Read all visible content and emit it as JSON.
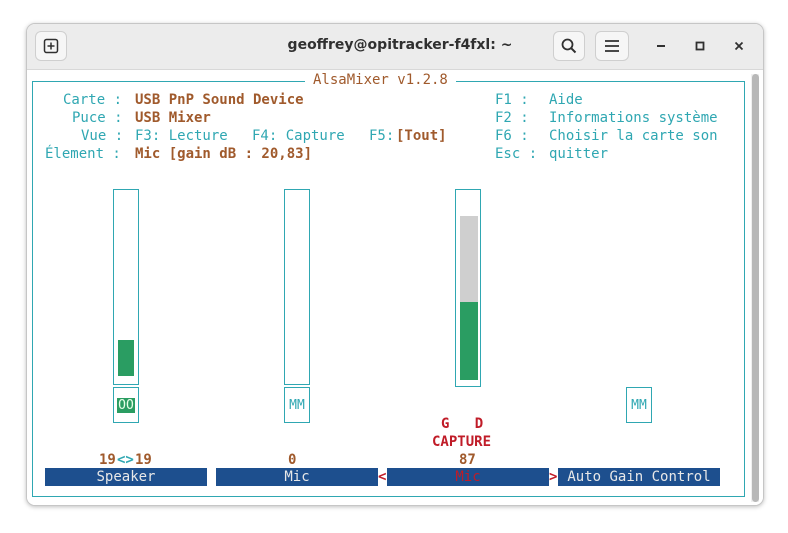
{
  "window": {
    "title": "geoffrey@opitracker-f4fxl: ~",
    "buttons": {
      "new_tab_icon": "new-tab-icon",
      "search_icon": "search-icon",
      "menu_icon": "hamburger-menu-icon",
      "minimize": "–",
      "maximize": "□",
      "close": "×"
    }
  },
  "alsamixer": {
    "title": "AlsaMixer v1.2.8",
    "info": {
      "carte_key": "Carte :",
      "carte_val": "USB PnP Sound Device",
      "puce_key": "Puce :",
      "puce_val": "USB Mixer",
      "vue_key": "Vue :",
      "vue_f3": "F3: Lecture",
      "vue_f4": "F4: Capture",
      "vue_f5": "F5:",
      "vue_f5_val": "[Tout]",
      "element_key": "Élement :",
      "element_val": "Mic [gain dB : 20,83]"
    },
    "help": [
      {
        "key": "F1 :",
        "label": "Aide"
      },
      {
        "key": "F2 :",
        "label": "Informations système"
      },
      {
        "key": "F6 :",
        "label": "Choisir la carte son"
      },
      {
        "key": "Esc :",
        "label": "quitter"
      }
    ],
    "controls": [
      {
        "name": "Speaker",
        "value_left": "19",
        "value_sep": "<>",
        "value_right": "19",
        "switch": "OO",
        "level": 19
      },
      {
        "name": "Mic",
        "value": "0",
        "switch": "MM",
        "level": 0
      },
      {
        "name": "Mic",
        "value": "87",
        "capture_flags": "G   D",
        "capture_label": "CAPTURE",
        "level": 87,
        "selected": true,
        "left_marker": "<",
        "right_marker": ">"
      },
      {
        "name": "Auto Gain Control",
        "switch": "MM"
      }
    ],
    "colors": {
      "accent": "#2fa7b2",
      "value": "#a05a2c",
      "label_bg": "#1d4f8e",
      "meter": "#2a9d62",
      "capture": "#c01c28"
    }
  }
}
